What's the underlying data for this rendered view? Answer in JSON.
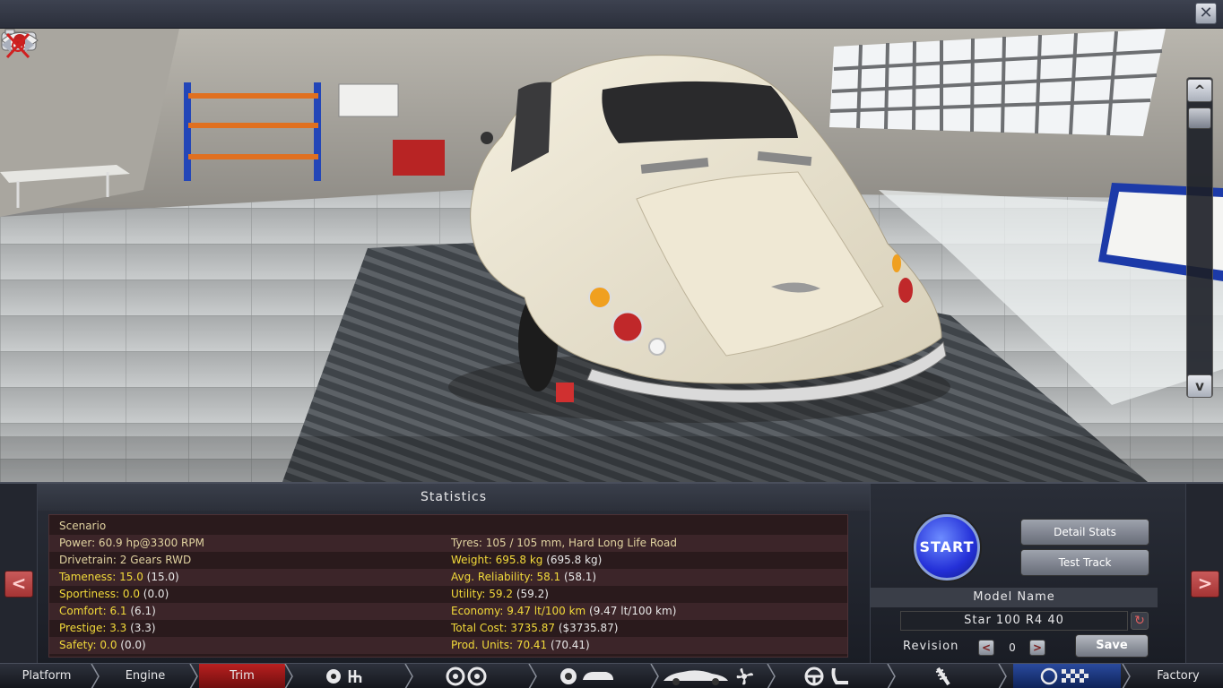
{
  "window": {
    "close_label": "✕"
  },
  "viewport": {
    "icons": [
      "camera-icon",
      "eye-icon",
      "scroll-up-icon",
      "scroll-down-icon",
      "grab-move-icon"
    ],
    "scroll_up_label": "^",
    "scroll_down_label": "v"
  },
  "statistics": {
    "title": "Statistics",
    "left": [
      {
        "key": "Scenario",
        "value": "",
        "highlight": false
      },
      {
        "key": "Power: 60.9 hp@3300 RPM",
        "value": "",
        "highlight": false
      },
      {
        "key": "Drivetrain: 2 Gears RWD",
        "value": "",
        "highlight": false
      },
      {
        "key": "Tameness: 15.0",
        "value": " (15.0)",
        "highlight": true
      },
      {
        "key": "Sportiness: 0.0",
        "value": " (0.0)",
        "highlight": true
      },
      {
        "key": "Comfort: 6.1",
        "value": " (6.1)",
        "highlight": true
      },
      {
        "key": "Prestige: 3.3",
        "value": " (3.3)",
        "highlight": true
      },
      {
        "key": "Safety: 0.0",
        "value": " (0.0)",
        "highlight": true
      }
    ],
    "right": [
      {
        "key": "",
        "value": "",
        "highlight": false
      },
      {
        "key": "Tyres: 105 / 105 mm, Hard Long Life Road",
        "value": "",
        "highlight": false
      },
      {
        "key": "Weight: 695.8 kg",
        "value": " (695.8 kg)",
        "highlight": true
      },
      {
        "key": "Avg. Reliability: 58.1",
        "value": " (58.1)",
        "highlight": true
      },
      {
        "key": "Utility: 59.2",
        "value": " (59.2)",
        "highlight": true
      },
      {
        "key": "Economy: 9.47 lt/100 km",
        "value": " (9.47 lt/100 km)",
        "highlight": true
      },
      {
        "key": "Total Cost: 3735.87",
        "value": " ($3735.87)",
        "highlight": true
      },
      {
        "key": "Prod. Units: 70.41",
        "value": " (70.41)",
        "highlight": true
      }
    ]
  },
  "actions": {
    "start_label": "START",
    "detail_stats_label": "Detail Stats",
    "test_track_label": "Test Track",
    "prev_label": "<",
    "next_label": ">"
  },
  "model": {
    "title": "Model Name",
    "name": "Star 100 R4 40",
    "revision_label": "Revision",
    "revision_value": "0",
    "rev_prev": "<",
    "rev_next": ">",
    "save_label": "Save",
    "refresh_icon": "refresh-icon"
  },
  "nav": {
    "platform": "Platform",
    "engine": "Engine",
    "trim": "Trim",
    "factory": "Factory",
    "active": "Trim",
    "icon_groups": [
      "engine-gearbox-icons",
      "wheels-icons",
      "body-icons",
      "car-aero-icons",
      "interior-icons",
      "suspension-icons",
      "test-drive-icons"
    ]
  },
  "colors": {
    "highlight_text": "#f2da3a",
    "active_tab": "#b82020",
    "start_blue": "#2430d8"
  }
}
